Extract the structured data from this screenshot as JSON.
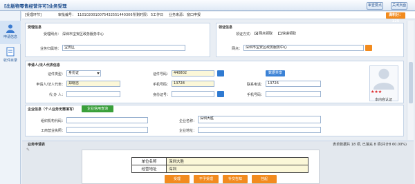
{
  "window": {
    "title": "[出版物零售经营许可]业务受理"
  },
  "top_buttons": {
    "approve": "审查要点",
    "close": "关闭页面"
  },
  "sidebar": {
    "items": [
      {
        "label": "申请信息"
      },
      {
        "label": "收件目录"
      }
    ]
  },
  "infobar": {
    "flow": "[受理环节]",
    "app_no_label": "审批编号：",
    "app_no": "1101020010075432551440306",
    "days_label": "所剩时限：",
    "days": "5工作日",
    "location_label": "业务来源：",
    "location": "窗口申报"
  },
  "score": "满积分：125",
  "acceptance": {
    "title": "受理信息",
    "site_label": "受理网点：",
    "site": "深圳市宝安区政务服务中心",
    "district_label": "业务归属地：",
    "district": "宝安区"
  },
  "pickup": {
    "title": "领证信息",
    "mode_label": "领证方式：",
    "option1": "网点领取",
    "option2": "快递领取",
    "site_label": "网点：",
    "site": "深圳市宝安区政务服务中心"
  },
  "applicant": {
    "title": "申请人/法人代表信息",
    "id_type_label": "证件类型：",
    "id_type": "身份证",
    "id_no_label": "证件号码：",
    "id_no": "440802",
    "read_card": "读卡",
    "share_btn": "数据共享",
    "name_label": "申请人/法人代表：",
    "name": "郑晓志",
    "mobile_label": "手机号码：",
    "mobile": "13728",
    "phone_label": "联系电话：",
    "phone": "13726",
    "agent_label": "代 办 人：",
    "agent_id_label": "身份证号：",
    "agent_mobile_label": "手机号码：",
    "verify_label": "本内容认证"
  },
  "company": {
    "title": "企业信息（个人业务无需填写）",
    "btn": "企业信用查询",
    "org_code_label": "组织机构代码：",
    "name_label": "企业名称：",
    "name": "深圳大胜",
    "license_label": "工商营业执照：",
    "addr_label": "企业地址："
  },
  "preview": {
    "title": "业务申请表",
    "stats": "表单数据共 18 项, 已填充 8 项(共计8 60.00%)",
    "row1_label": "单位名称",
    "row1_value": "深圳大胜",
    "row2_label": "经营地址",
    "row2_value": "深圳"
  },
  "bottom_buttons": {
    "b1": "受理",
    "b2": "不予受理",
    "b3": "补交告知",
    "b4": "挂起"
  }
}
